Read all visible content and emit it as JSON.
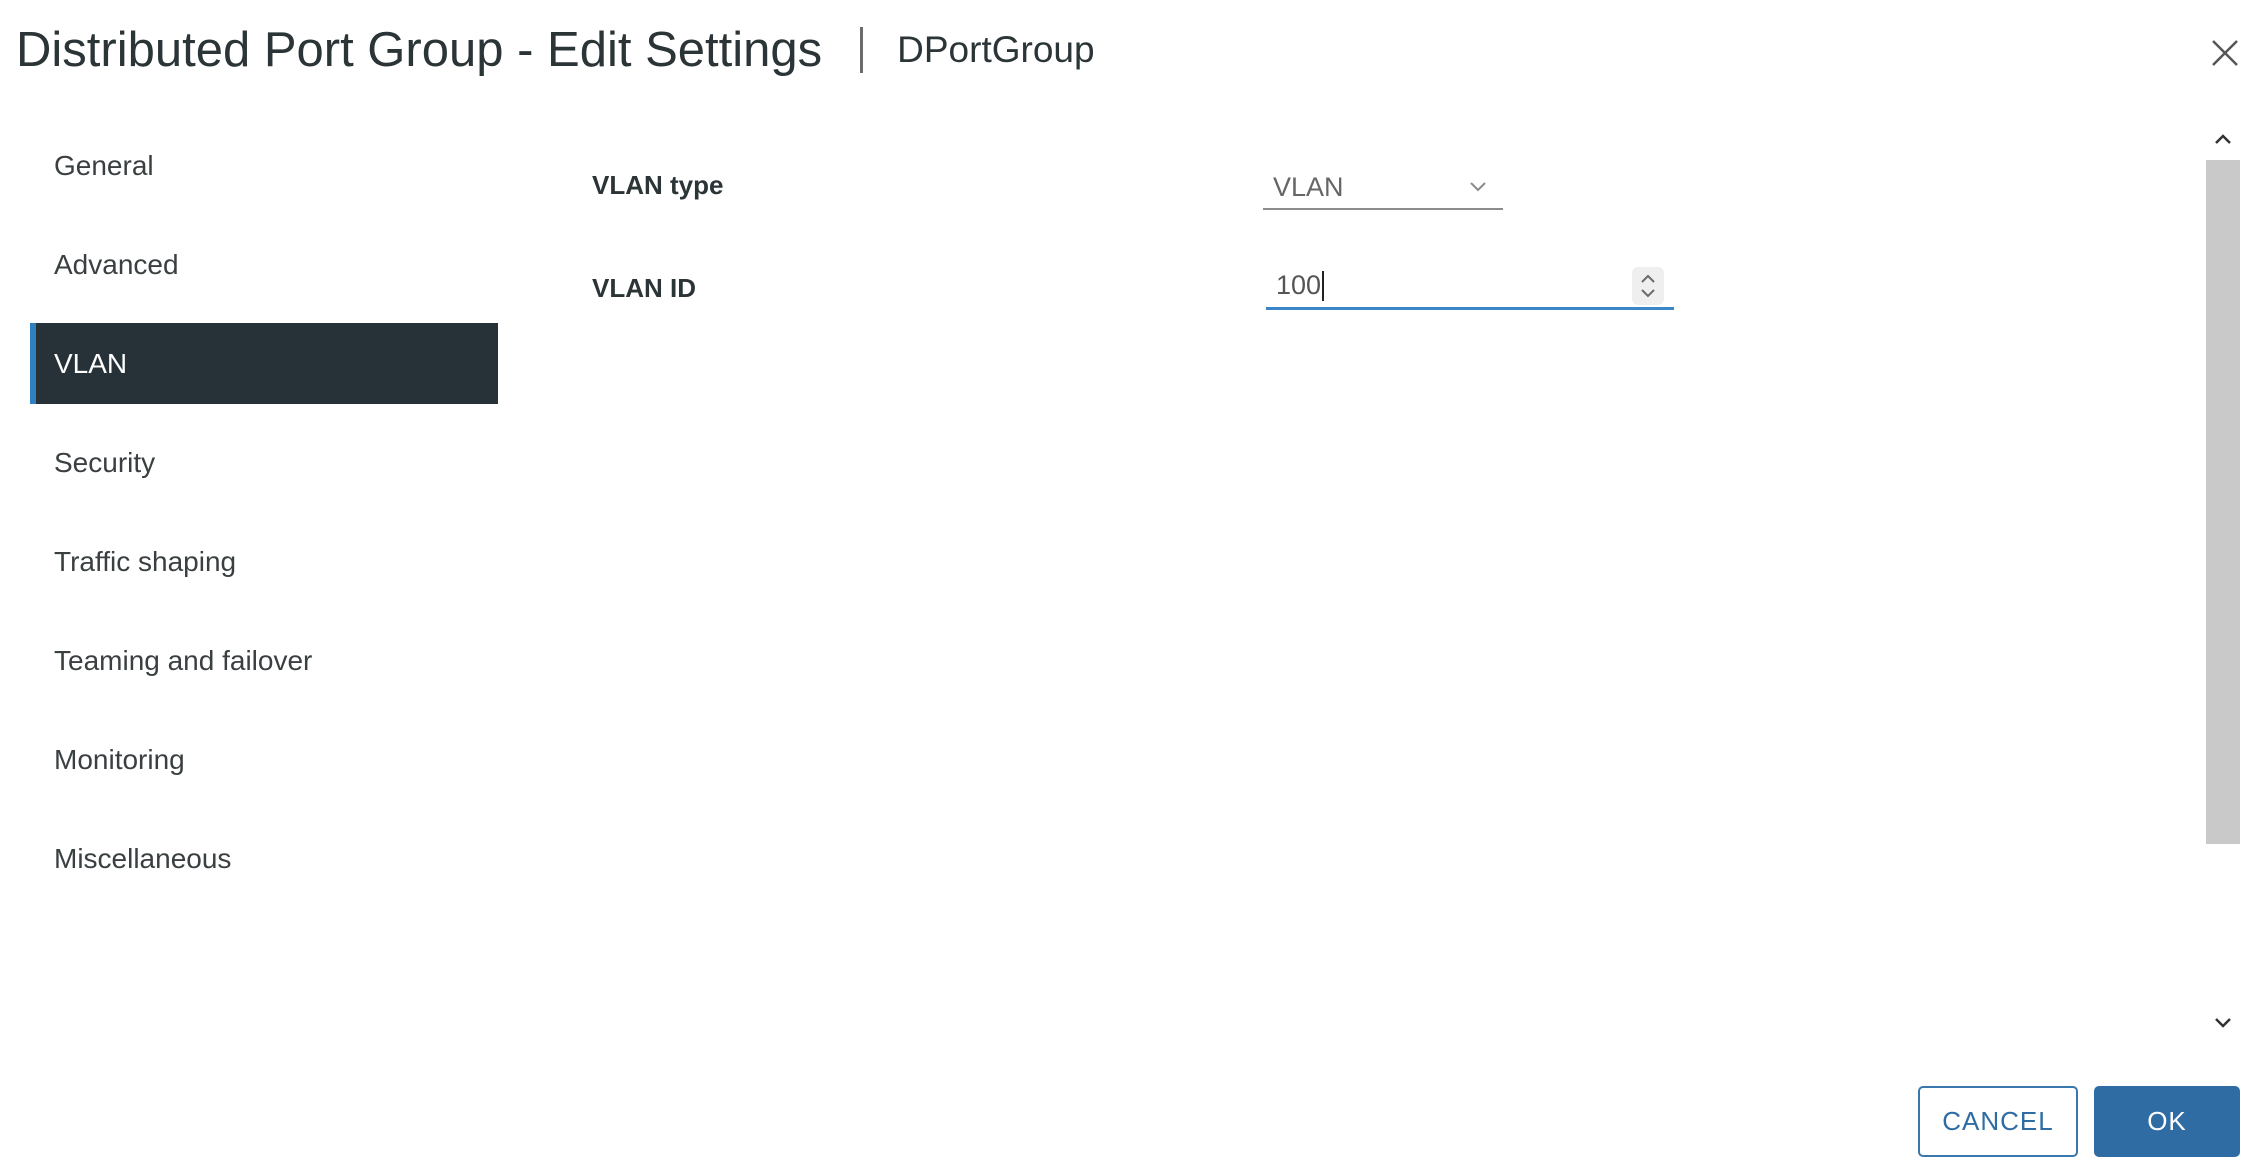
{
  "header": {
    "title": "Distributed Port Group - Edit Settings",
    "subtitle": "DPortGroup",
    "close_icon": "close-icon"
  },
  "nav": {
    "items": [
      {
        "label": "General",
        "active": false
      },
      {
        "label": "Advanced",
        "active": false
      },
      {
        "label": "VLAN",
        "active": true
      },
      {
        "label": "Security",
        "active": false
      },
      {
        "label": "Traffic shaping",
        "active": false
      },
      {
        "label": "Teaming and failover",
        "active": false
      },
      {
        "label": "Monitoring",
        "active": false
      },
      {
        "label": "Miscellaneous",
        "active": false
      }
    ]
  },
  "form": {
    "vlan_type_label": "VLAN type",
    "vlan_type_value": "VLAN",
    "vlan_id_label": "VLAN ID",
    "vlan_id_value": "100"
  },
  "footer": {
    "cancel_label": "CANCEL",
    "ok_label": "OK"
  },
  "colors": {
    "active_nav_bg": "#263238",
    "active_nav_accent": "#2f7fc1",
    "primary": "#2f6ca3",
    "focus_underline": "#3a86c8"
  }
}
